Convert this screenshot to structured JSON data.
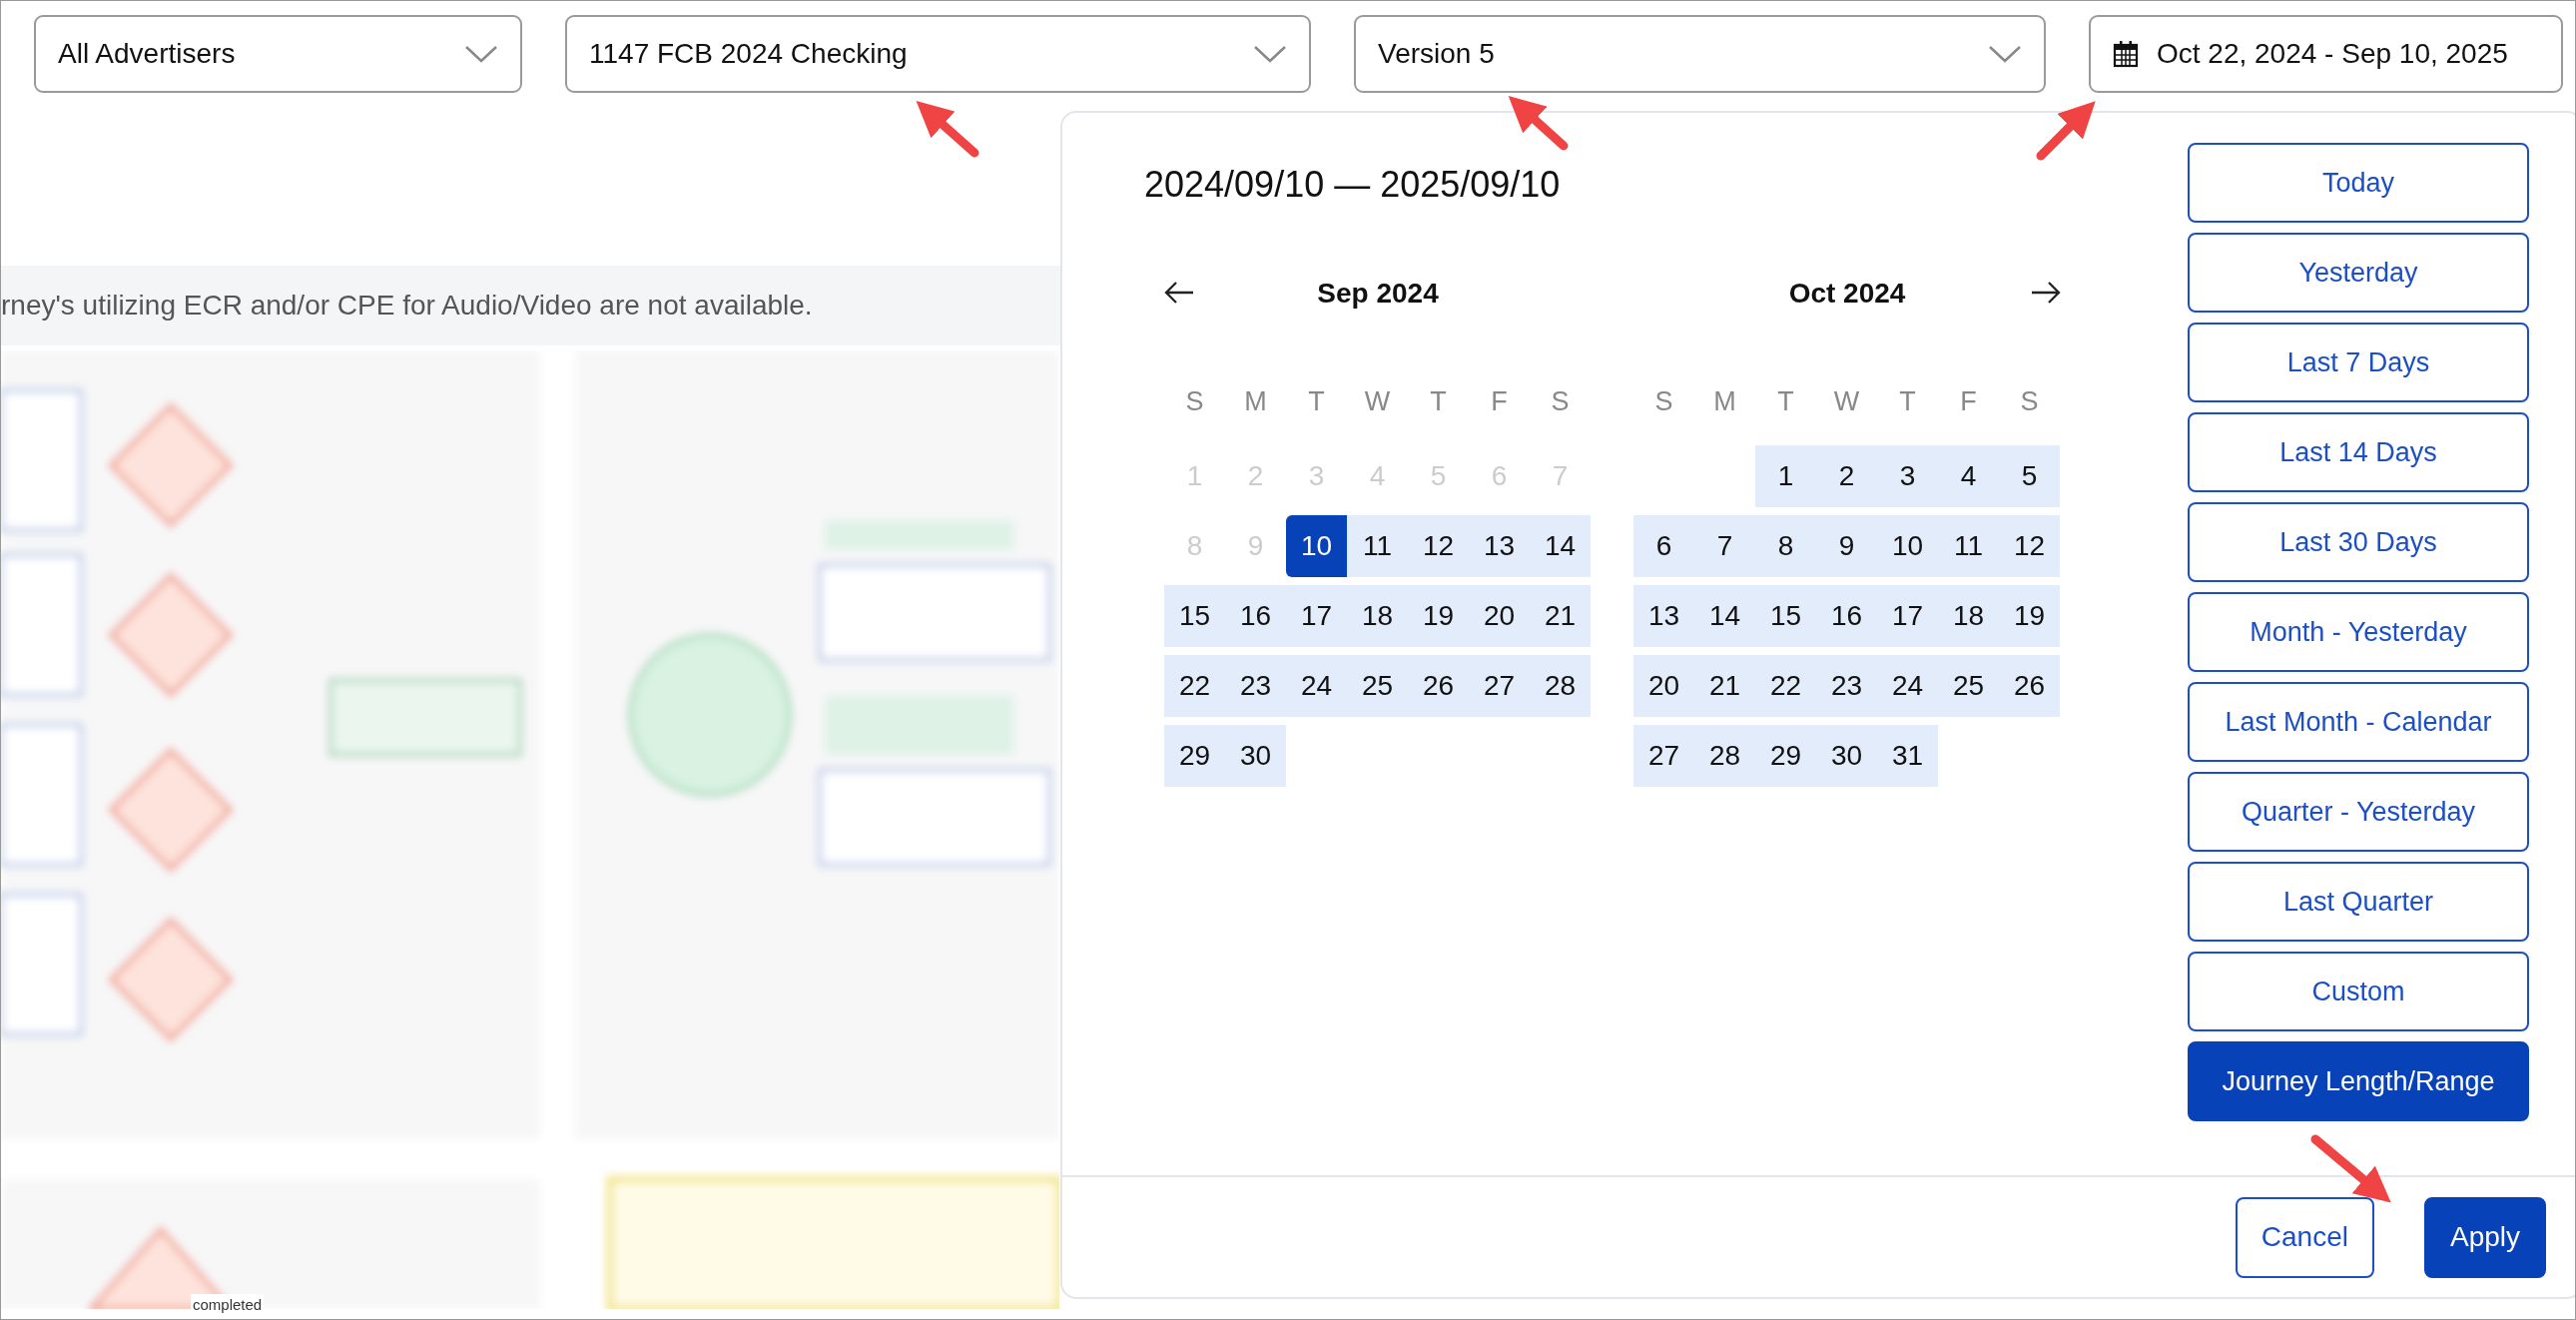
{
  "filters": [
    {
      "kind": "select",
      "value": "All Advertisers"
    },
    {
      "kind": "select",
      "value": "1147 FCB 2024 Checking"
    },
    {
      "kind": "select",
      "value": "Version 5"
    },
    {
      "kind": "date",
      "value": "Oct 22, 2024 - Sep 10, 2025"
    }
  ],
  "notice": "rney's utilizing ECR and/or CPE for Audio/Video are not available.",
  "diagram_label": "completed",
  "date_picker": {
    "range_title": "2024/09/10 — 2025/09/10",
    "months": [
      {
        "title": "Sep 2024",
        "weekdays": [
          "S",
          "M",
          "T",
          "W",
          "T",
          "F",
          "S"
        ],
        "days": [
          {
            "kind": "day",
            "label": "1",
            "disabled": true,
            "in_range": false,
            "selected": false
          },
          {
            "kind": "day",
            "label": "2",
            "disabled": true,
            "in_range": false,
            "selected": false
          },
          {
            "kind": "day",
            "label": "3",
            "disabled": true,
            "in_range": false,
            "selected": false
          },
          {
            "kind": "day",
            "label": "4",
            "disabled": true,
            "in_range": false,
            "selected": false
          },
          {
            "kind": "day",
            "label": "5",
            "disabled": true,
            "in_range": false,
            "selected": false
          },
          {
            "kind": "day",
            "label": "6",
            "disabled": true,
            "in_range": false,
            "selected": false
          },
          {
            "kind": "day",
            "label": "7",
            "disabled": true,
            "in_range": false,
            "selected": false
          },
          {
            "kind": "day",
            "label": "8",
            "disabled": true,
            "in_range": false,
            "selected": false
          },
          {
            "kind": "day",
            "label": "9",
            "disabled": true,
            "in_range": false,
            "selected": false
          },
          {
            "kind": "day",
            "label": "10",
            "disabled": false,
            "in_range": true,
            "selected": true
          },
          {
            "kind": "day",
            "label": "11",
            "disabled": false,
            "in_range": true,
            "selected": false
          },
          {
            "kind": "day",
            "label": "12",
            "disabled": false,
            "in_range": true,
            "selected": false
          },
          {
            "kind": "day",
            "label": "13",
            "disabled": false,
            "in_range": true,
            "selected": false
          },
          {
            "kind": "day",
            "label": "14",
            "disabled": false,
            "in_range": true,
            "selected": false
          },
          {
            "kind": "day",
            "label": "15",
            "disabled": false,
            "in_range": true,
            "selected": false
          },
          {
            "kind": "day",
            "label": "16",
            "disabled": false,
            "in_range": true,
            "selected": false
          },
          {
            "kind": "day",
            "label": "17",
            "disabled": false,
            "in_range": true,
            "selected": false
          },
          {
            "kind": "day",
            "label": "18",
            "disabled": false,
            "in_range": true,
            "selected": false
          },
          {
            "kind": "day",
            "label": "19",
            "disabled": false,
            "in_range": true,
            "selected": false
          },
          {
            "kind": "day",
            "label": "20",
            "disabled": false,
            "in_range": true,
            "selected": false
          },
          {
            "kind": "day",
            "label": "21",
            "disabled": false,
            "in_range": true,
            "selected": false
          },
          {
            "kind": "day",
            "label": "22",
            "disabled": false,
            "in_range": true,
            "selected": false
          },
          {
            "kind": "day",
            "label": "23",
            "disabled": false,
            "in_range": true,
            "selected": false
          },
          {
            "kind": "day",
            "label": "24",
            "disabled": false,
            "in_range": true,
            "selected": false
          },
          {
            "kind": "day",
            "label": "25",
            "disabled": false,
            "in_range": true,
            "selected": false
          },
          {
            "kind": "day",
            "label": "26",
            "disabled": false,
            "in_range": true,
            "selected": false
          },
          {
            "kind": "day",
            "label": "27",
            "disabled": false,
            "in_range": true,
            "selected": false
          },
          {
            "kind": "day",
            "label": "28",
            "disabled": false,
            "in_range": true,
            "selected": false
          },
          {
            "kind": "day",
            "label": "29",
            "disabled": false,
            "in_range": true,
            "selected": false
          },
          {
            "kind": "day",
            "label": "30",
            "disabled": false,
            "in_range": true,
            "selected": false
          }
        ]
      },
      {
        "title": "Oct 2024",
        "weekdays": [
          "S",
          "M",
          "T",
          "W",
          "T",
          "F",
          "S"
        ],
        "days": [
          {
            "kind": "blank"
          },
          {
            "kind": "blank"
          },
          {
            "kind": "day",
            "label": "1",
            "disabled": false,
            "in_range": true,
            "selected": false
          },
          {
            "kind": "day",
            "label": "2",
            "disabled": false,
            "in_range": true,
            "selected": false
          },
          {
            "kind": "day",
            "label": "3",
            "disabled": false,
            "in_range": true,
            "selected": false
          },
          {
            "kind": "day",
            "label": "4",
            "disabled": false,
            "in_range": true,
            "selected": false
          },
          {
            "kind": "day",
            "label": "5",
            "disabled": false,
            "in_range": true,
            "selected": false
          },
          {
            "kind": "day",
            "label": "6",
            "disabled": false,
            "in_range": true,
            "selected": false
          },
          {
            "kind": "day",
            "label": "7",
            "disabled": false,
            "in_range": true,
            "selected": false
          },
          {
            "kind": "day",
            "label": "8",
            "disabled": false,
            "in_range": true,
            "selected": false
          },
          {
            "kind": "day",
            "label": "9",
            "disabled": false,
            "in_range": true,
            "selected": false
          },
          {
            "kind": "day",
            "label": "10",
            "disabled": false,
            "in_range": true,
            "selected": false
          },
          {
            "kind": "day",
            "label": "11",
            "disabled": false,
            "in_range": true,
            "selected": false
          },
          {
            "kind": "day",
            "label": "12",
            "disabled": false,
            "in_range": true,
            "selected": false
          },
          {
            "kind": "day",
            "label": "13",
            "disabled": false,
            "in_range": true,
            "selected": false
          },
          {
            "kind": "day",
            "label": "14",
            "disabled": false,
            "in_range": true,
            "selected": false
          },
          {
            "kind": "day",
            "label": "15",
            "disabled": false,
            "in_range": true,
            "selected": false
          },
          {
            "kind": "day",
            "label": "16",
            "disabled": false,
            "in_range": true,
            "selected": false
          },
          {
            "kind": "day",
            "label": "17",
            "disabled": false,
            "in_range": true,
            "selected": false
          },
          {
            "kind": "day",
            "label": "18",
            "disabled": false,
            "in_range": true,
            "selected": false
          },
          {
            "kind": "day",
            "label": "19",
            "disabled": false,
            "in_range": true,
            "selected": false
          },
          {
            "kind": "day",
            "label": "20",
            "disabled": false,
            "in_range": true,
            "selected": false
          },
          {
            "kind": "day",
            "label": "21",
            "disabled": false,
            "in_range": true,
            "selected": false
          },
          {
            "kind": "day",
            "label": "22",
            "disabled": false,
            "in_range": true,
            "selected": false
          },
          {
            "kind": "day",
            "label": "23",
            "disabled": false,
            "in_range": true,
            "selected": false
          },
          {
            "kind": "day",
            "label": "24",
            "disabled": false,
            "in_range": true,
            "selected": false
          },
          {
            "kind": "day",
            "label": "25",
            "disabled": false,
            "in_range": true,
            "selected": false
          },
          {
            "kind": "day",
            "label": "26",
            "disabled": false,
            "in_range": true,
            "selected": false
          },
          {
            "kind": "day",
            "label": "27",
            "disabled": false,
            "in_range": true,
            "selected": false
          },
          {
            "kind": "day",
            "label": "28",
            "disabled": false,
            "in_range": true,
            "selected": false
          },
          {
            "kind": "day",
            "label": "29",
            "disabled": false,
            "in_range": true,
            "selected": false
          },
          {
            "kind": "day",
            "label": "30",
            "disabled": false,
            "in_range": true,
            "selected": false
          },
          {
            "kind": "day",
            "label": "31",
            "disabled": false,
            "in_range": true,
            "selected": false
          }
        ]
      }
    ],
    "presets": [
      {
        "label": "Today",
        "selected": false
      },
      {
        "label": "Yesterday",
        "selected": false
      },
      {
        "label": "Last 7 Days",
        "selected": false
      },
      {
        "label": "Last 14 Days",
        "selected": false
      },
      {
        "label": "Last 30 Days",
        "selected": false
      },
      {
        "label": "Month - Yesterday",
        "selected": false
      },
      {
        "label": "Last Month - Calendar",
        "selected": false
      },
      {
        "label": "Quarter - Yesterday",
        "selected": false
      },
      {
        "label": "Last Quarter",
        "selected": false
      },
      {
        "label": "Custom",
        "selected": false
      },
      {
        "label": "Journey Length/Range",
        "selected": true
      }
    ],
    "buttons": [
      {
        "kind": "secondary",
        "label": "Cancel"
      },
      {
        "kind": "primary",
        "label": "Apply"
      }
    ]
  }
}
